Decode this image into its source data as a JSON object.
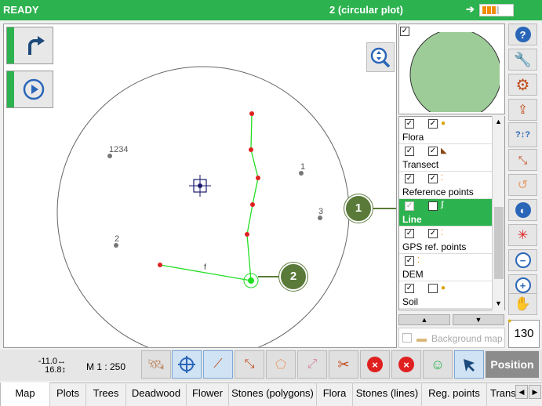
{
  "topbar": {
    "status": "READY",
    "plot": "2 (circular plot)",
    "arrow": "➔"
  },
  "map": {
    "points": [
      {
        "label": "1234"
      },
      {
        "label": "1"
      },
      {
        "label": "3"
      },
      {
        "label": "2"
      }
    ],
    "line_label": "f",
    "callouts": [
      "1",
      "2"
    ]
  },
  "layers": {
    "items": [
      {
        "name": "Flora",
        "cb1": "☑",
        "cb2": "☑"
      },
      {
        "name": "Transect",
        "cb1": "☑",
        "cb2": "☑"
      },
      {
        "name": "Reference points",
        "cb1": "☑",
        "cb2": "☑"
      },
      {
        "name": "Line",
        "cb1": "☑",
        "cb2": "☑"
      },
      {
        "name": "GPS ref. points",
        "cb1": "☑",
        "cb2": "☑"
      },
      {
        "name": "DEM",
        "cb1": "☑",
        "cb2": ""
      },
      {
        "name": "Soil",
        "cb1": "☑",
        "cb2": "☐"
      }
    ],
    "selected": "Line"
  },
  "background_map": {
    "label": "Background map"
  },
  "counter": "130",
  "bottom": {
    "coord_x": "-11.0↔",
    "coord_y": "16.8↕",
    "scale": "M 1 : 250",
    "position_label": "Position"
  },
  "tabs": [
    "Map",
    "Plots",
    "Trees",
    "Deadwood",
    "Flower",
    "Stones (polygons)",
    "Flora",
    "Stones (lines)",
    "Reg. points",
    "Trans"
  ],
  "colors": {
    "accent": "#2cb24e",
    "callout": "#5a7a3a",
    "line": "#22dd22",
    "vertex": "#e02020"
  },
  "icons": [
    "redo-icon",
    "play-icon",
    "zoom-fit-icon",
    "help-icon",
    "wrench-icon",
    "gear-icon",
    "upload-icon",
    "query-icon",
    "select-icon",
    "lasso-icon",
    "globe-icon",
    "compress-icon",
    "zoom-out-icon",
    "zoom-in-icon",
    "hand-icon",
    "satellite-icon",
    "crosshair-icon",
    "draw-line-icon",
    "edit-points-icon",
    "polygon-icon",
    "move-vertex-icon",
    "split-icon",
    "delete-line-icon",
    "delete-point-icon",
    "person-icon",
    "pointer-icon"
  ]
}
